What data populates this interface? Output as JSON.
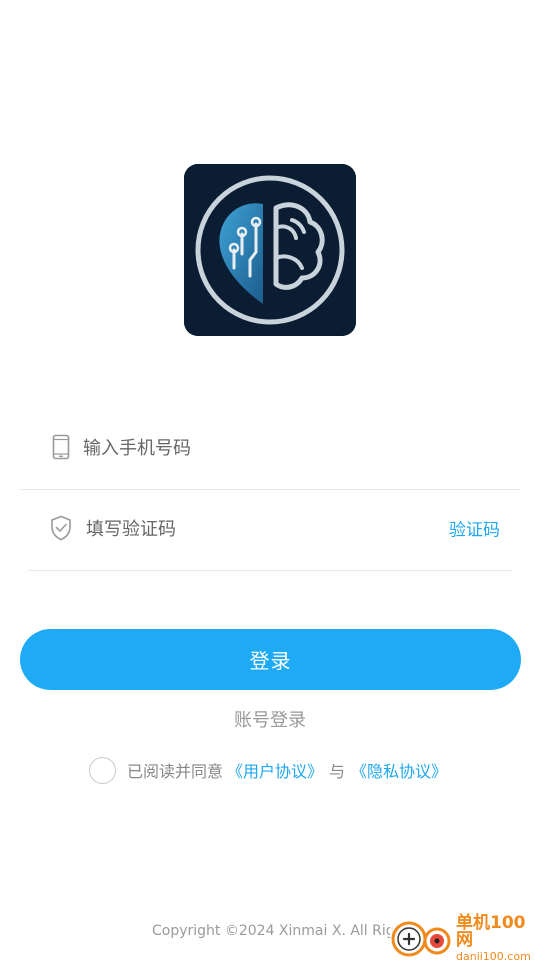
{
  "app": {
    "logo_icon": "brain-circuit-logo-icon"
  },
  "form": {
    "phone_placeholder": "输入手机号码",
    "phone_icon": "phone-icon",
    "code_placeholder": "填写验证码",
    "code_icon": "shield-check-icon",
    "get_code_label": "验证码"
  },
  "actions": {
    "login_label": "登录",
    "account_login_label": "账号登录"
  },
  "agreement": {
    "prefix": "已阅读并同意",
    "user_agreement": "《用户协议》",
    "conjunction": "与",
    "privacy_policy": "《隐私协议》",
    "checked": false
  },
  "footer": {
    "copyright": "Copyright ©2024 Xinmai X. All Rights"
  },
  "watermark": {
    "name": "单机100网",
    "url": "danji100.com"
  },
  "colors": {
    "accent": "#1eaaf5",
    "link": "#1ea7f2",
    "logo_bg": "#0b1d33"
  }
}
